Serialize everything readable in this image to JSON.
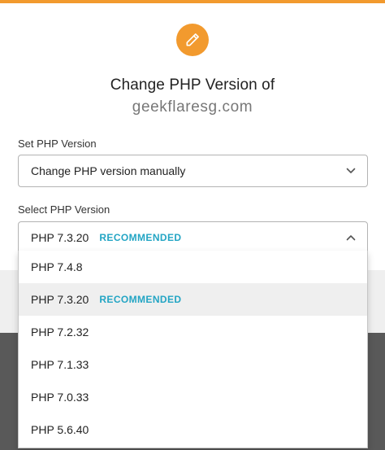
{
  "dialog": {
    "title": "Change PHP Version of",
    "domain": "geekflaresg.com",
    "accent_color": "#f29a2e",
    "icon": "pencil-icon"
  },
  "set_php_version": {
    "label": "Set PHP Version",
    "value": "Change PHP version manually"
  },
  "select_php_version": {
    "label": "Select PHP Version",
    "value": "PHP 7.3.20",
    "badge": "RECOMMENDED",
    "badge_color": "#23a5c4",
    "expanded": true
  },
  "dropdown": {
    "options": [
      {
        "label": "PHP 7.4.8",
        "badge": ""
      },
      {
        "label": "PHP 7.3.20",
        "badge": "RECOMMENDED",
        "selected": true
      },
      {
        "label": "PHP 7.2.32",
        "badge": ""
      },
      {
        "label": "PHP 7.1.33",
        "badge": ""
      },
      {
        "label": "PHP 7.0.33",
        "badge": ""
      },
      {
        "label": "PHP 5.6.40",
        "badge": ""
      }
    ]
  }
}
